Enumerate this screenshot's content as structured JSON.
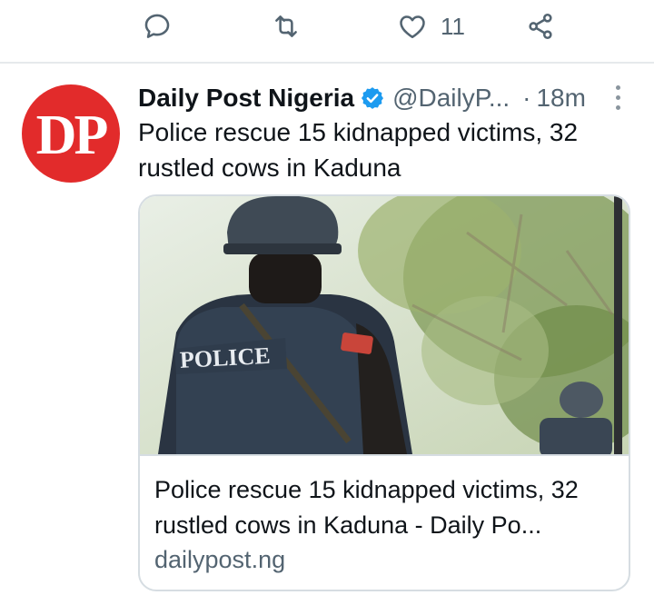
{
  "action_bar": {
    "reply_icon": "speech-bubble-icon",
    "retweet_icon": "retweet-icon",
    "like_icon": "heart-icon",
    "like_count": "11",
    "share_icon": "share-icon"
  },
  "tweet": {
    "avatar_text": "DP",
    "avatar_color": "#e22b2b",
    "display_name": "Daily Post Nigeria",
    "verified_icon": "verified-badge-icon",
    "verified_color": "#1d9bf0",
    "handle": "@DailyP...",
    "separator": "·",
    "time": "18m",
    "more_icon": "vertical-ellipsis-icon",
    "text": "Police rescue 15 kidnapped victims, 32 rustled cows in Kaduna"
  },
  "card": {
    "image_label": "POLICE",
    "title": "Police rescue 15 kidnapped victims, 32 rustled cows in Kaduna - Daily Po...",
    "domain": "dailypost.ng"
  }
}
